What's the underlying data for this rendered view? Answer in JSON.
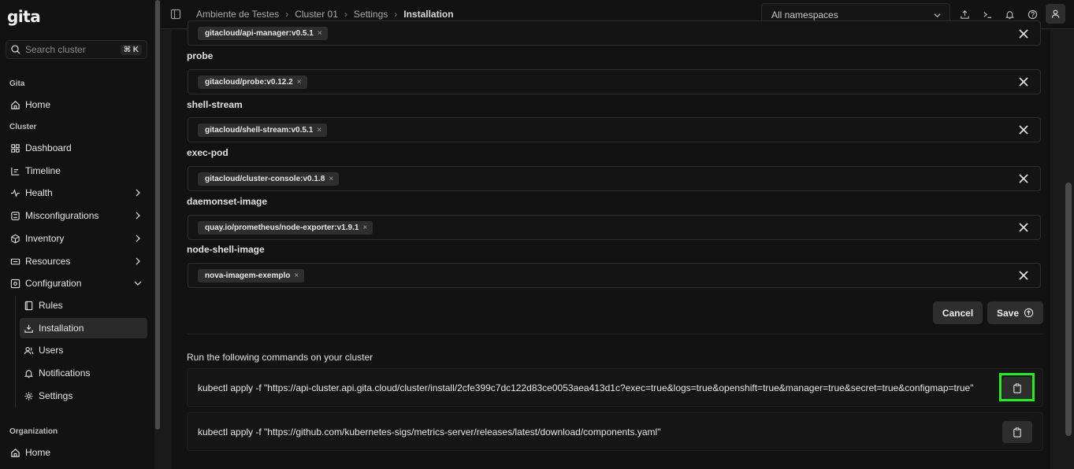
{
  "logo": "gita",
  "search": {
    "placeholder": "Search cluster",
    "shortcut": "⌘ K"
  },
  "sidebar": {
    "sections": [
      {
        "label": "Gita"
      },
      {
        "label": "Cluster"
      },
      {
        "label": "Organization"
      }
    ],
    "gita_items": [
      {
        "label": "Home",
        "icon": "home-icon"
      }
    ],
    "cluster_items": [
      {
        "label": "Dashboard",
        "icon": "dashboard-icon"
      },
      {
        "label": "Timeline",
        "icon": "timeline-icon"
      },
      {
        "label": "Health",
        "icon": "health-icon"
      },
      {
        "label": "Misconfigurations",
        "icon": "misconfigurations-icon"
      },
      {
        "label": "Inventory",
        "icon": "inventory-icon"
      },
      {
        "label": "Resources",
        "icon": "resources-icon"
      },
      {
        "label": "Configuration",
        "icon": "configuration-icon"
      }
    ],
    "configuration_items": [
      {
        "label": "Rules",
        "icon": "book-icon"
      },
      {
        "label": "Installation",
        "icon": "download-icon"
      },
      {
        "label": "Users",
        "icon": "users-icon"
      },
      {
        "label": "Notifications",
        "icon": "bell-icon"
      },
      {
        "label": "Settings",
        "icon": "gear-icon"
      }
    ],
    "organization_items": [
      {
        "label": "Home",
        "icon": "home-icon"
      }
    ]
  },
  "breadcrumb": [
    "Ambiente de Testes",
    "Cluster 01",
    "Settings",
    "Installation"
  ],
  "namespace_select": {
    "value": "All namespaces"
  },
  "fields": [
    {
      "label": "",
      "chip": "gitacloud/api-manager:v0.5.1"
    },
    {
      "label": "probe",
      "chip": "gitacloud/probe:v0.12.2"
    },
    {
      "label": "shell-stream",
      "chip": "gitacloud/shell-stream:v0.5.1"
    },
    {
      "label": "exec-pod",
      "chip": "gitacloud/cluster-console:v0.1.8"
    },
    {
      "label": "daemonset-image",
      "chip": "quay.io/prometheus/node-exporter:v1.9.1"
    },
    {
      "label": "node-shell-image",
      "chip": "nova-imagem-exemplo"
    }
  ],
  "chip_remove": "×",
  "actions": {
    "cancel": "Cancel",
    "save": "Save"
  },
  "commands": {
    "title": "Run the following commands on your cluster",
    "items": [
      "kubectl apply -f \"https://api-cluster.api.gita.cloud/cluster/install/2cfe399c7dc122d83ce0053aea413d1c?exec=true&logs=true&openshift=true&manager=true&secret=true&configmap=true\"",
      "kubectl apply -f \"https://github.com/kubernetes-sigs/metrics-server/releases/latest/download/components.yaml\""
    ]
  },
  "colors": {
    "highlight": "#22ee22",
    "background": "#121212",
    "chip": "#2e2e2e"
  }
}
